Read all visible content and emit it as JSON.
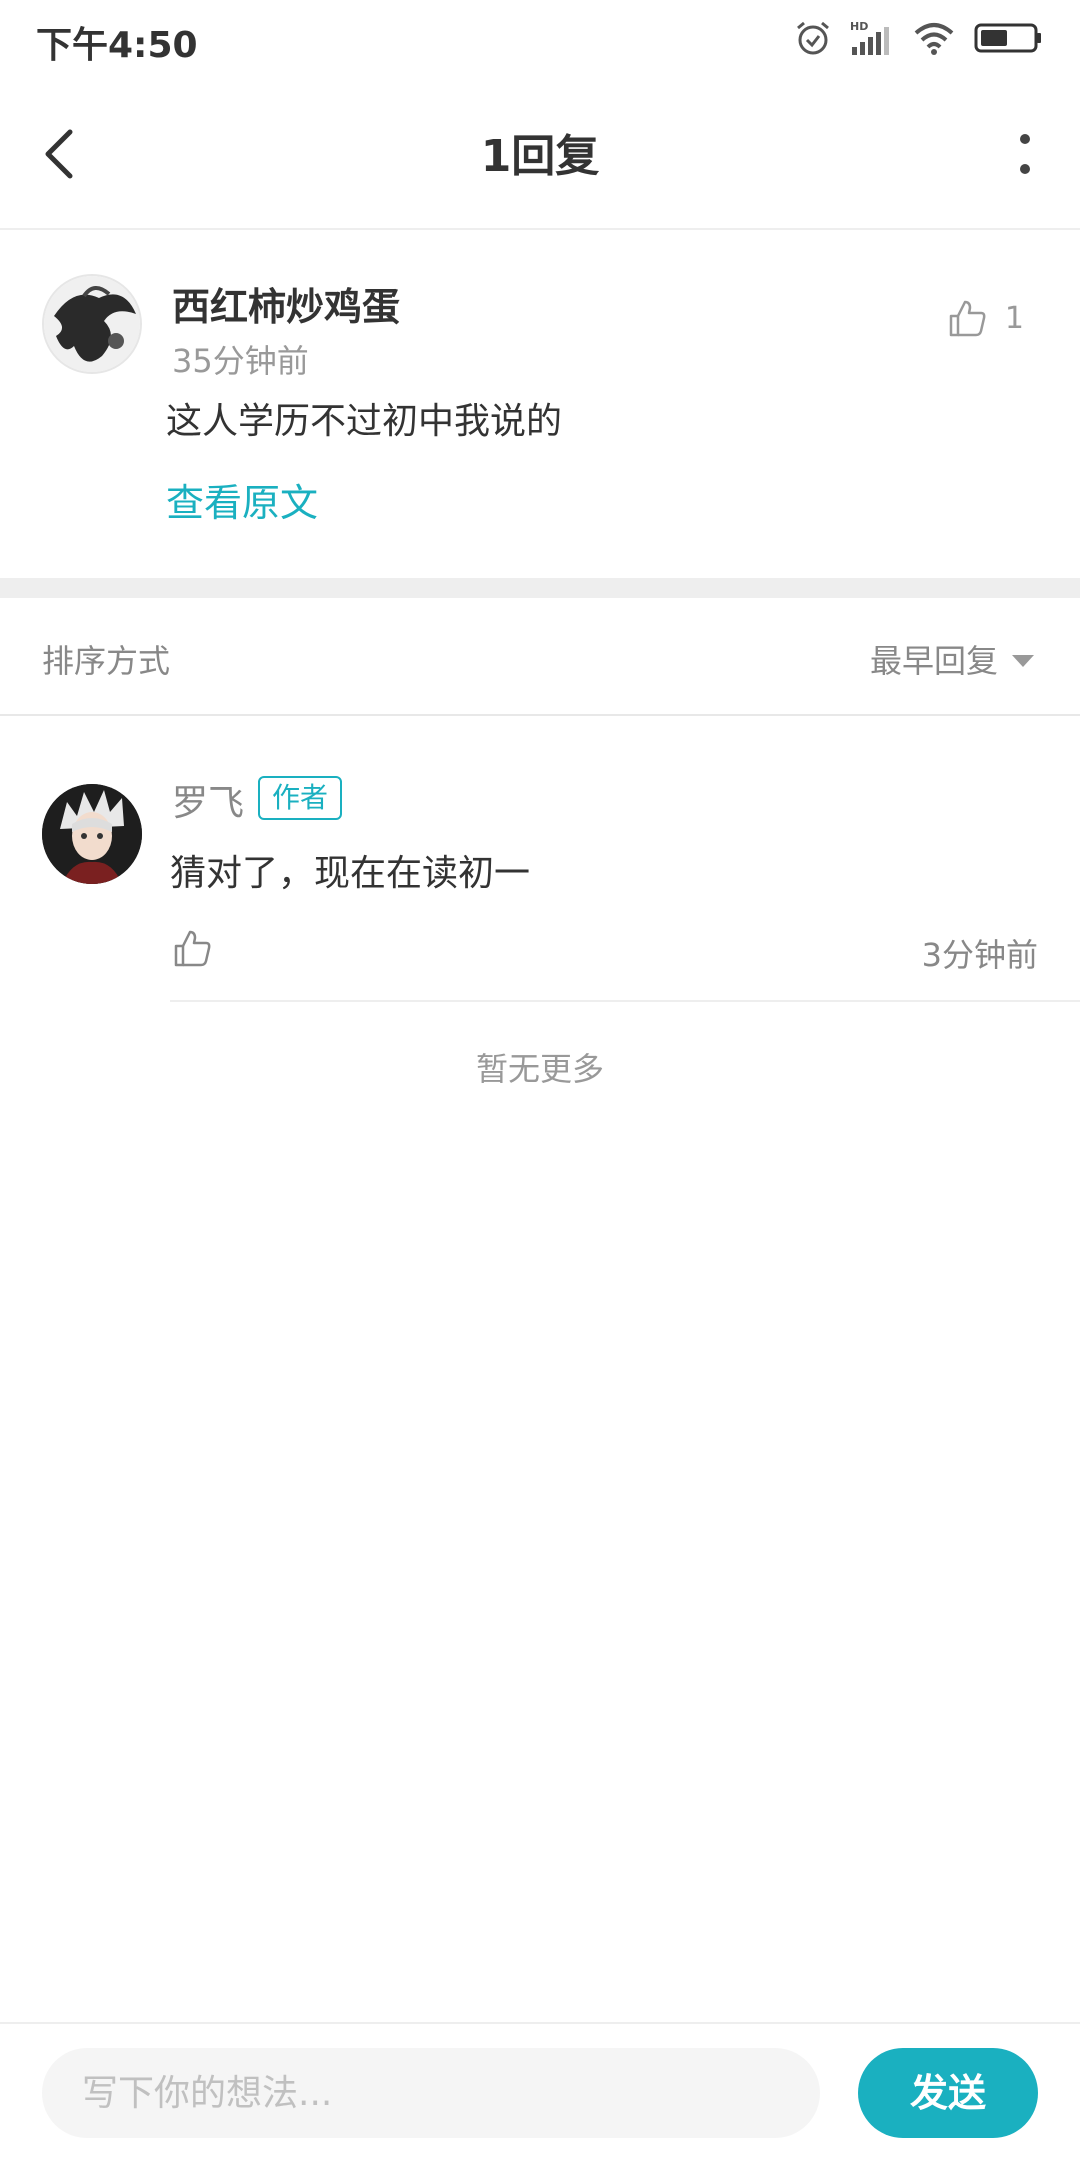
{
  "status_bar": {
    "time": "下午4:50",
    "network_label": "HD",
    "icons": [
      "alarm-icon",
      "signal-icon",
      "wifi-icon",
      "battery-icon"
    ]
  },
  "header": {
    "title": "1回复",
    "back_icon": "chevron-left-icon",
    "more_icon": "more-vertical-icon"
  },
  "original_comment": {
    "author": "西红柿炒鸡蛋",
    "time": "35分钟前",
    "text": "这人学历不过初中我说的",
    "view_original_link": "查看原文",
    "like_count": "1"
  },
  "sort": {
    "label": "排序方式",
    "selected": "最早回复"
  },
  "replies": [
    {
      "author": "罗飞",
      "badge": "作者",
      "text": "猜对了，现在在读初一",
      "time": "3分钟前"
    }
  ],
  "no_more_text": "暂无更多",
  "composer": {
    "placeholder": "写下你的想法...",
    "send_label": "发送"
  },
  "colors": {
    "accent": "#1ab0c0",
    "divider": "#eeeeee",
    "muted_text": "#999999"
  }
}
